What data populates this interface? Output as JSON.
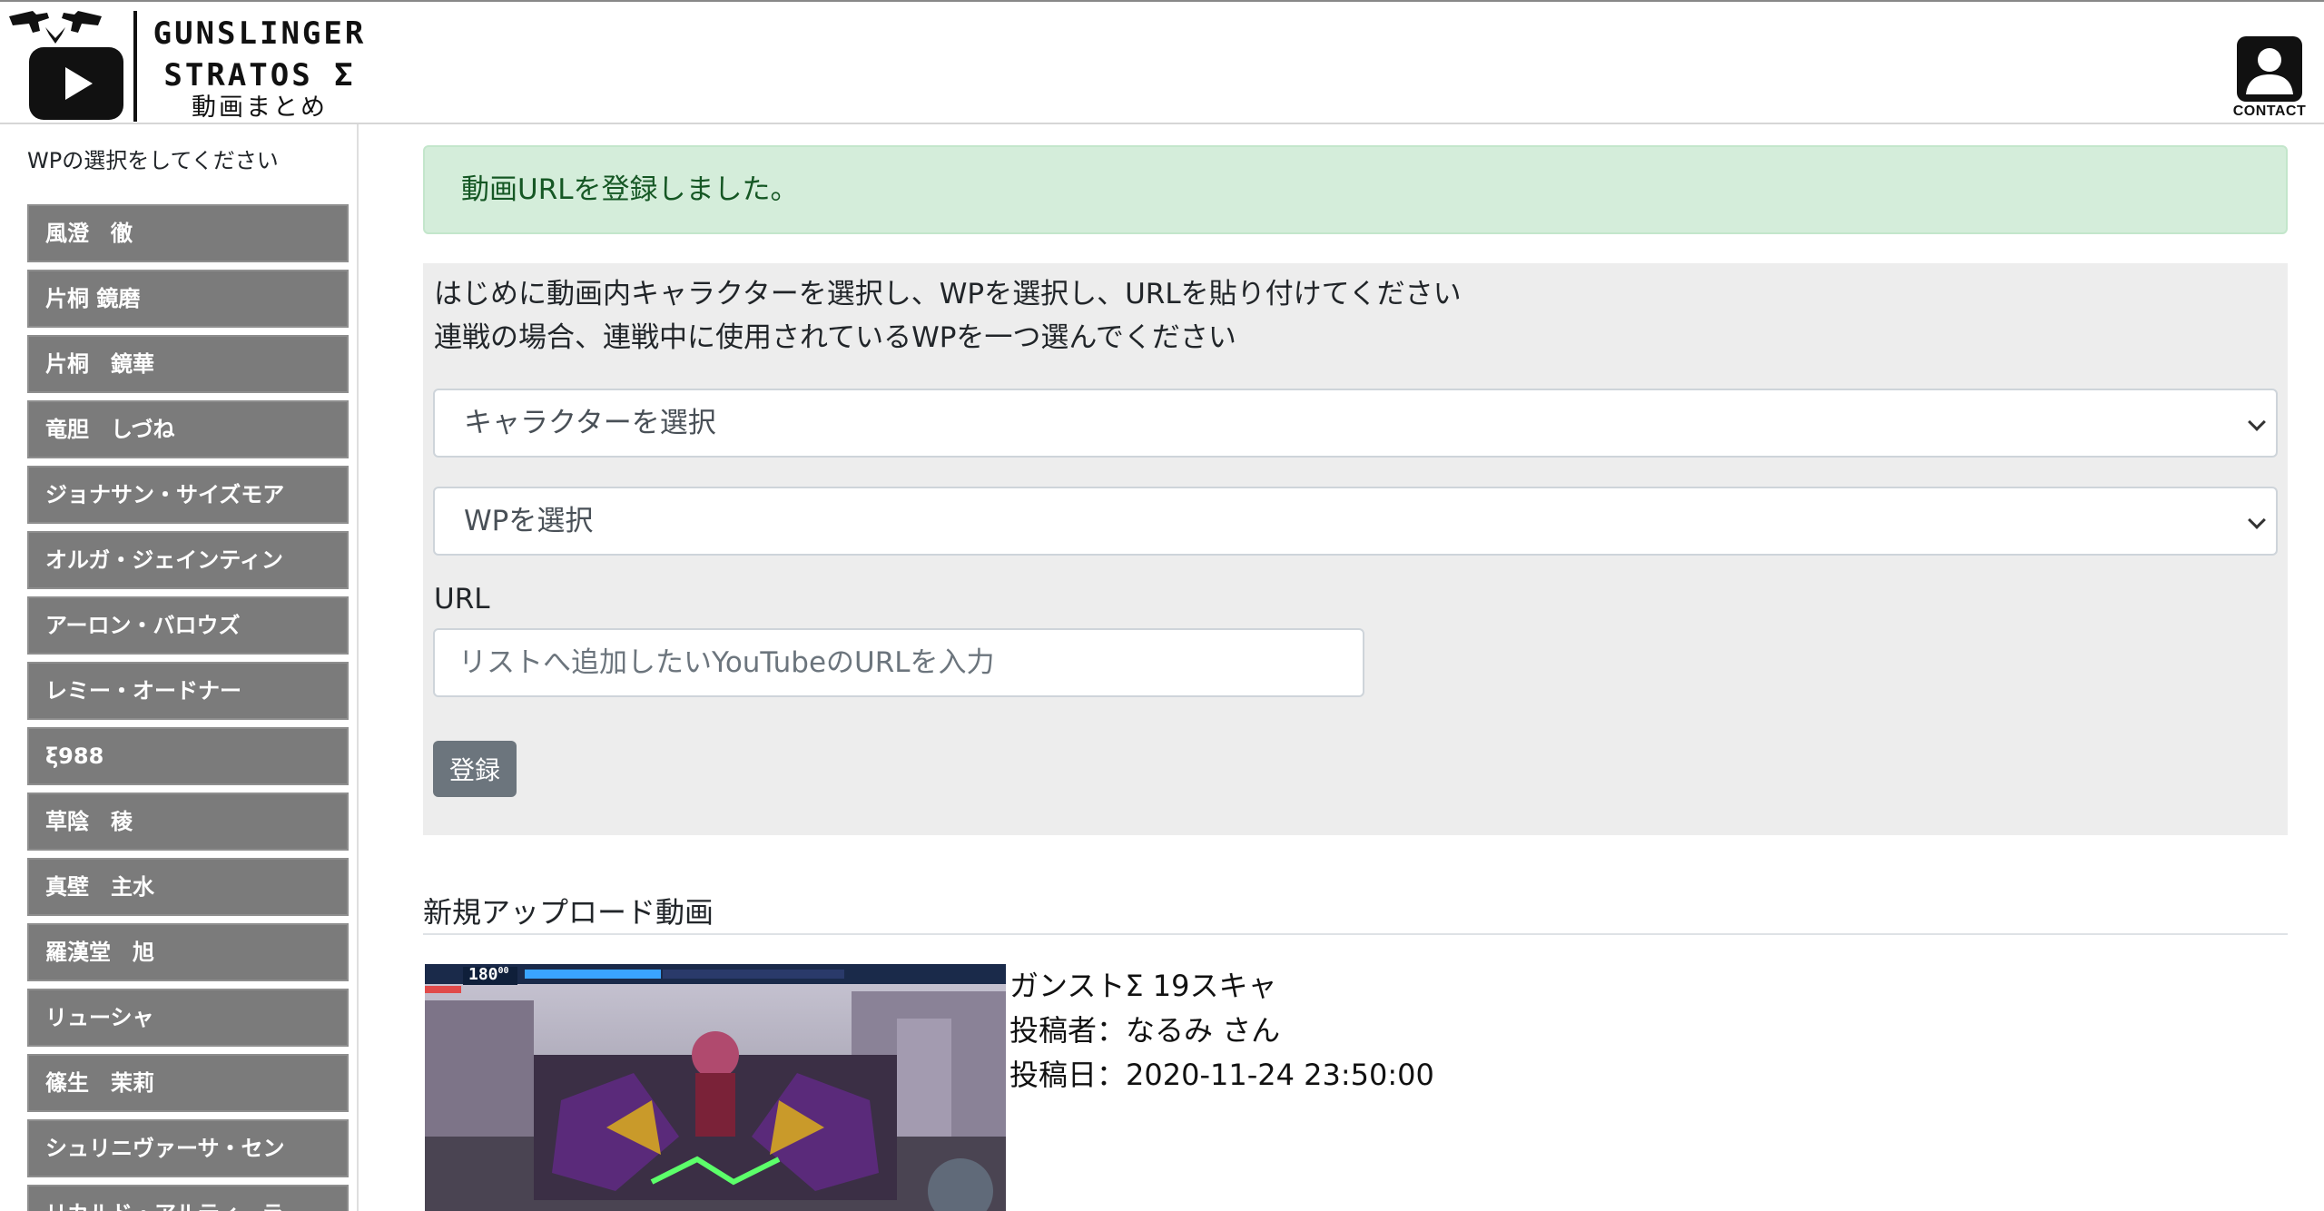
{
  "header": {
    "logo_line1": "GUNSLINGER",
    "logo_line2": "STRATOS Σ",
    "logo_sub": "動画まとめ",
    "contact_label": "CONTACT"
  },
  "sidebar": {
    "title": "WPの選択をしてください",
    "items": [
      {
        "label": "風澄　徹"
      },
      {
        "label": "片桐 鏡磨"
      },
      {
        "label": "片桐　鏡華"
      },
      {
        "label": "竜胆　しづね"
      },
      {
        "label": "ジョナサン・サイズモア"
      },
      {
        "label": "オルガ・ジェインティン"
      },
      {
        "label": "アーロン・バロウズ"
      },
      {
        "label": "レミー・オードナー"
      },
      {
        "label": "ξ988"
      },
      {
        "label": "草陰　稜"
      },
      {
        "label": "真壁　主水"
      },
      {
        "label": "羅漢堂　旭"
      },
      {
        "label": "リューシャ"
      },
      {
        "label": "篠生　茉莉"
      },
      {
        "label": "シュリニヴァーサ・セン"
      },
      {
        "label": "リカルド・アルティーラ"
      }
    ]
  },
  "alert": {
    "text": "動画URLを登録しました。"
  },
  "form": {
    "instruction_line1": "はじめに動画内キャラクターを選択し、WPを選択し、URLを貼り付けてください",
    "instruction_line2": "連戦の場合、連戦中に使用されているWPを一つ選んでください",
    "character_select": "キャラクターを選択",
    "wp_select": "WPを選択",
    "url_label": "URL",
    "url_placeholder": "リストへ追加したいYouTubeのURLを入力",
    "submit_label": "登録"
  },
  "new_uploads": {
    "title": "新規アップロード動画",
    "video": {
      "title": "ガンストΣ 19スキャ",
      "poster": "投稿者：なるみ さん",
      "date": "投稿日：2020-11-24 23:50:00",
      "hud_value": "180",
      "hud_sup": "00"
    }
  },
  "colors": {
    "alert_bg": "#d4edda",
    "alert_text": "#155724",
    "sidebar_button": "#7b7b7b",
    "submit_button": "#6c757d",
    "panel_bg": "#ededed"
  }
}
